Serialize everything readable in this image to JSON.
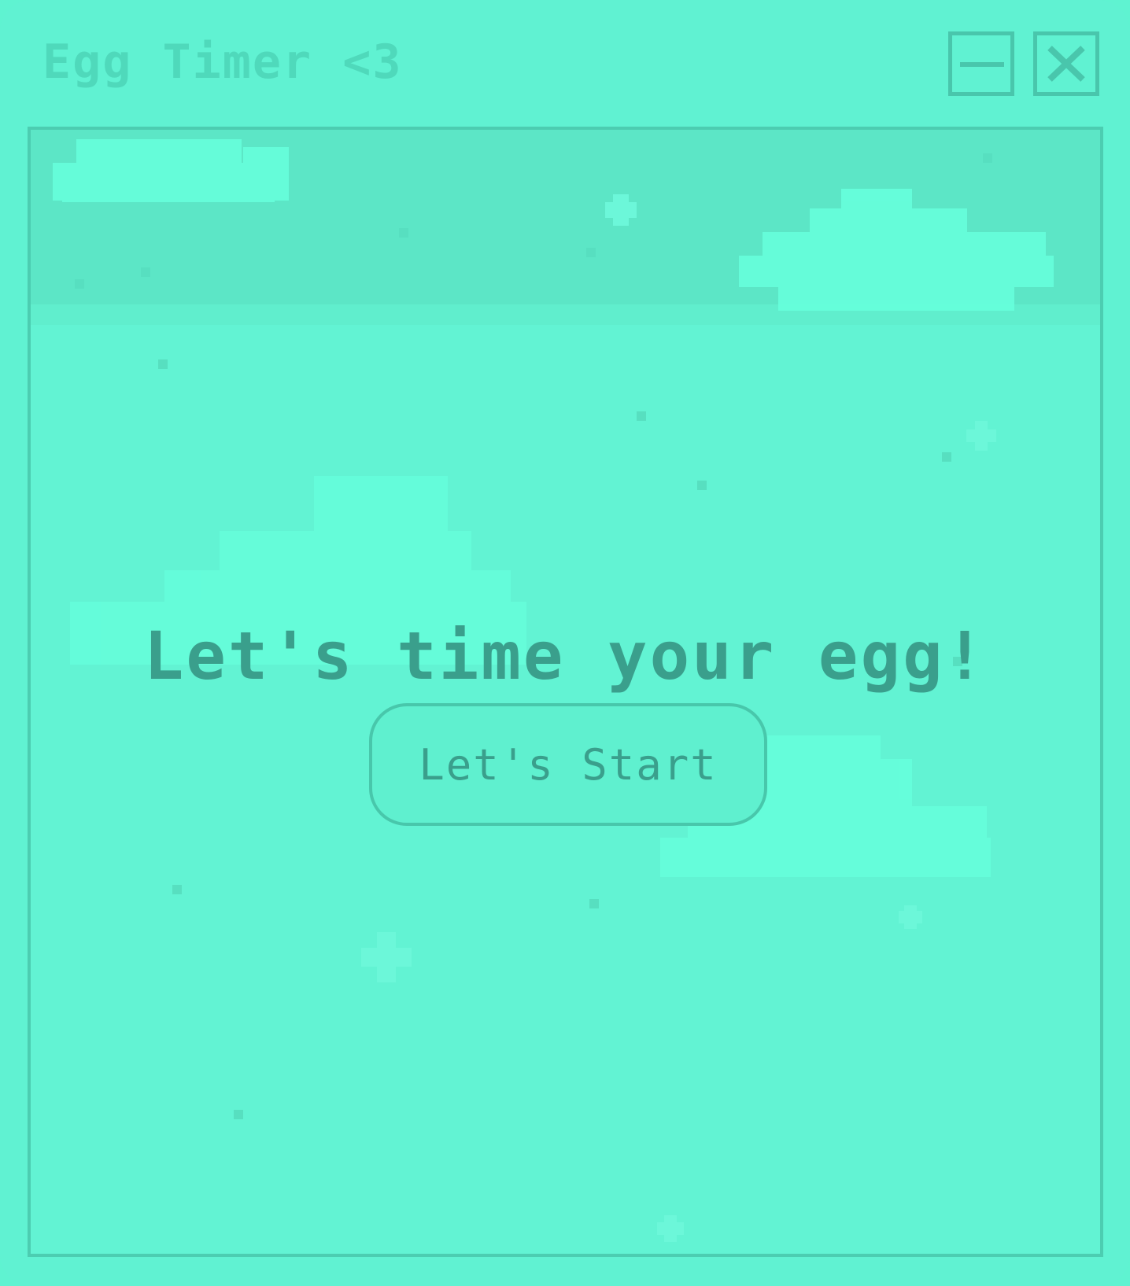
{
  "window": {
    "title": "Egg Timer <3",
    "minimize_icon": "minimize-icon",
    "close_icon": "close-icon"
  },
  "main": {
    "heading": "Let's time your egg!",
    "start_label": "Let's Start"
  },
  "colors": {
    "background": "#60f2d2",
    "accent": "#3a9f8c",
    "border": "#4ccdb1",
    "cloud": "#66ffdc"
  }
}
